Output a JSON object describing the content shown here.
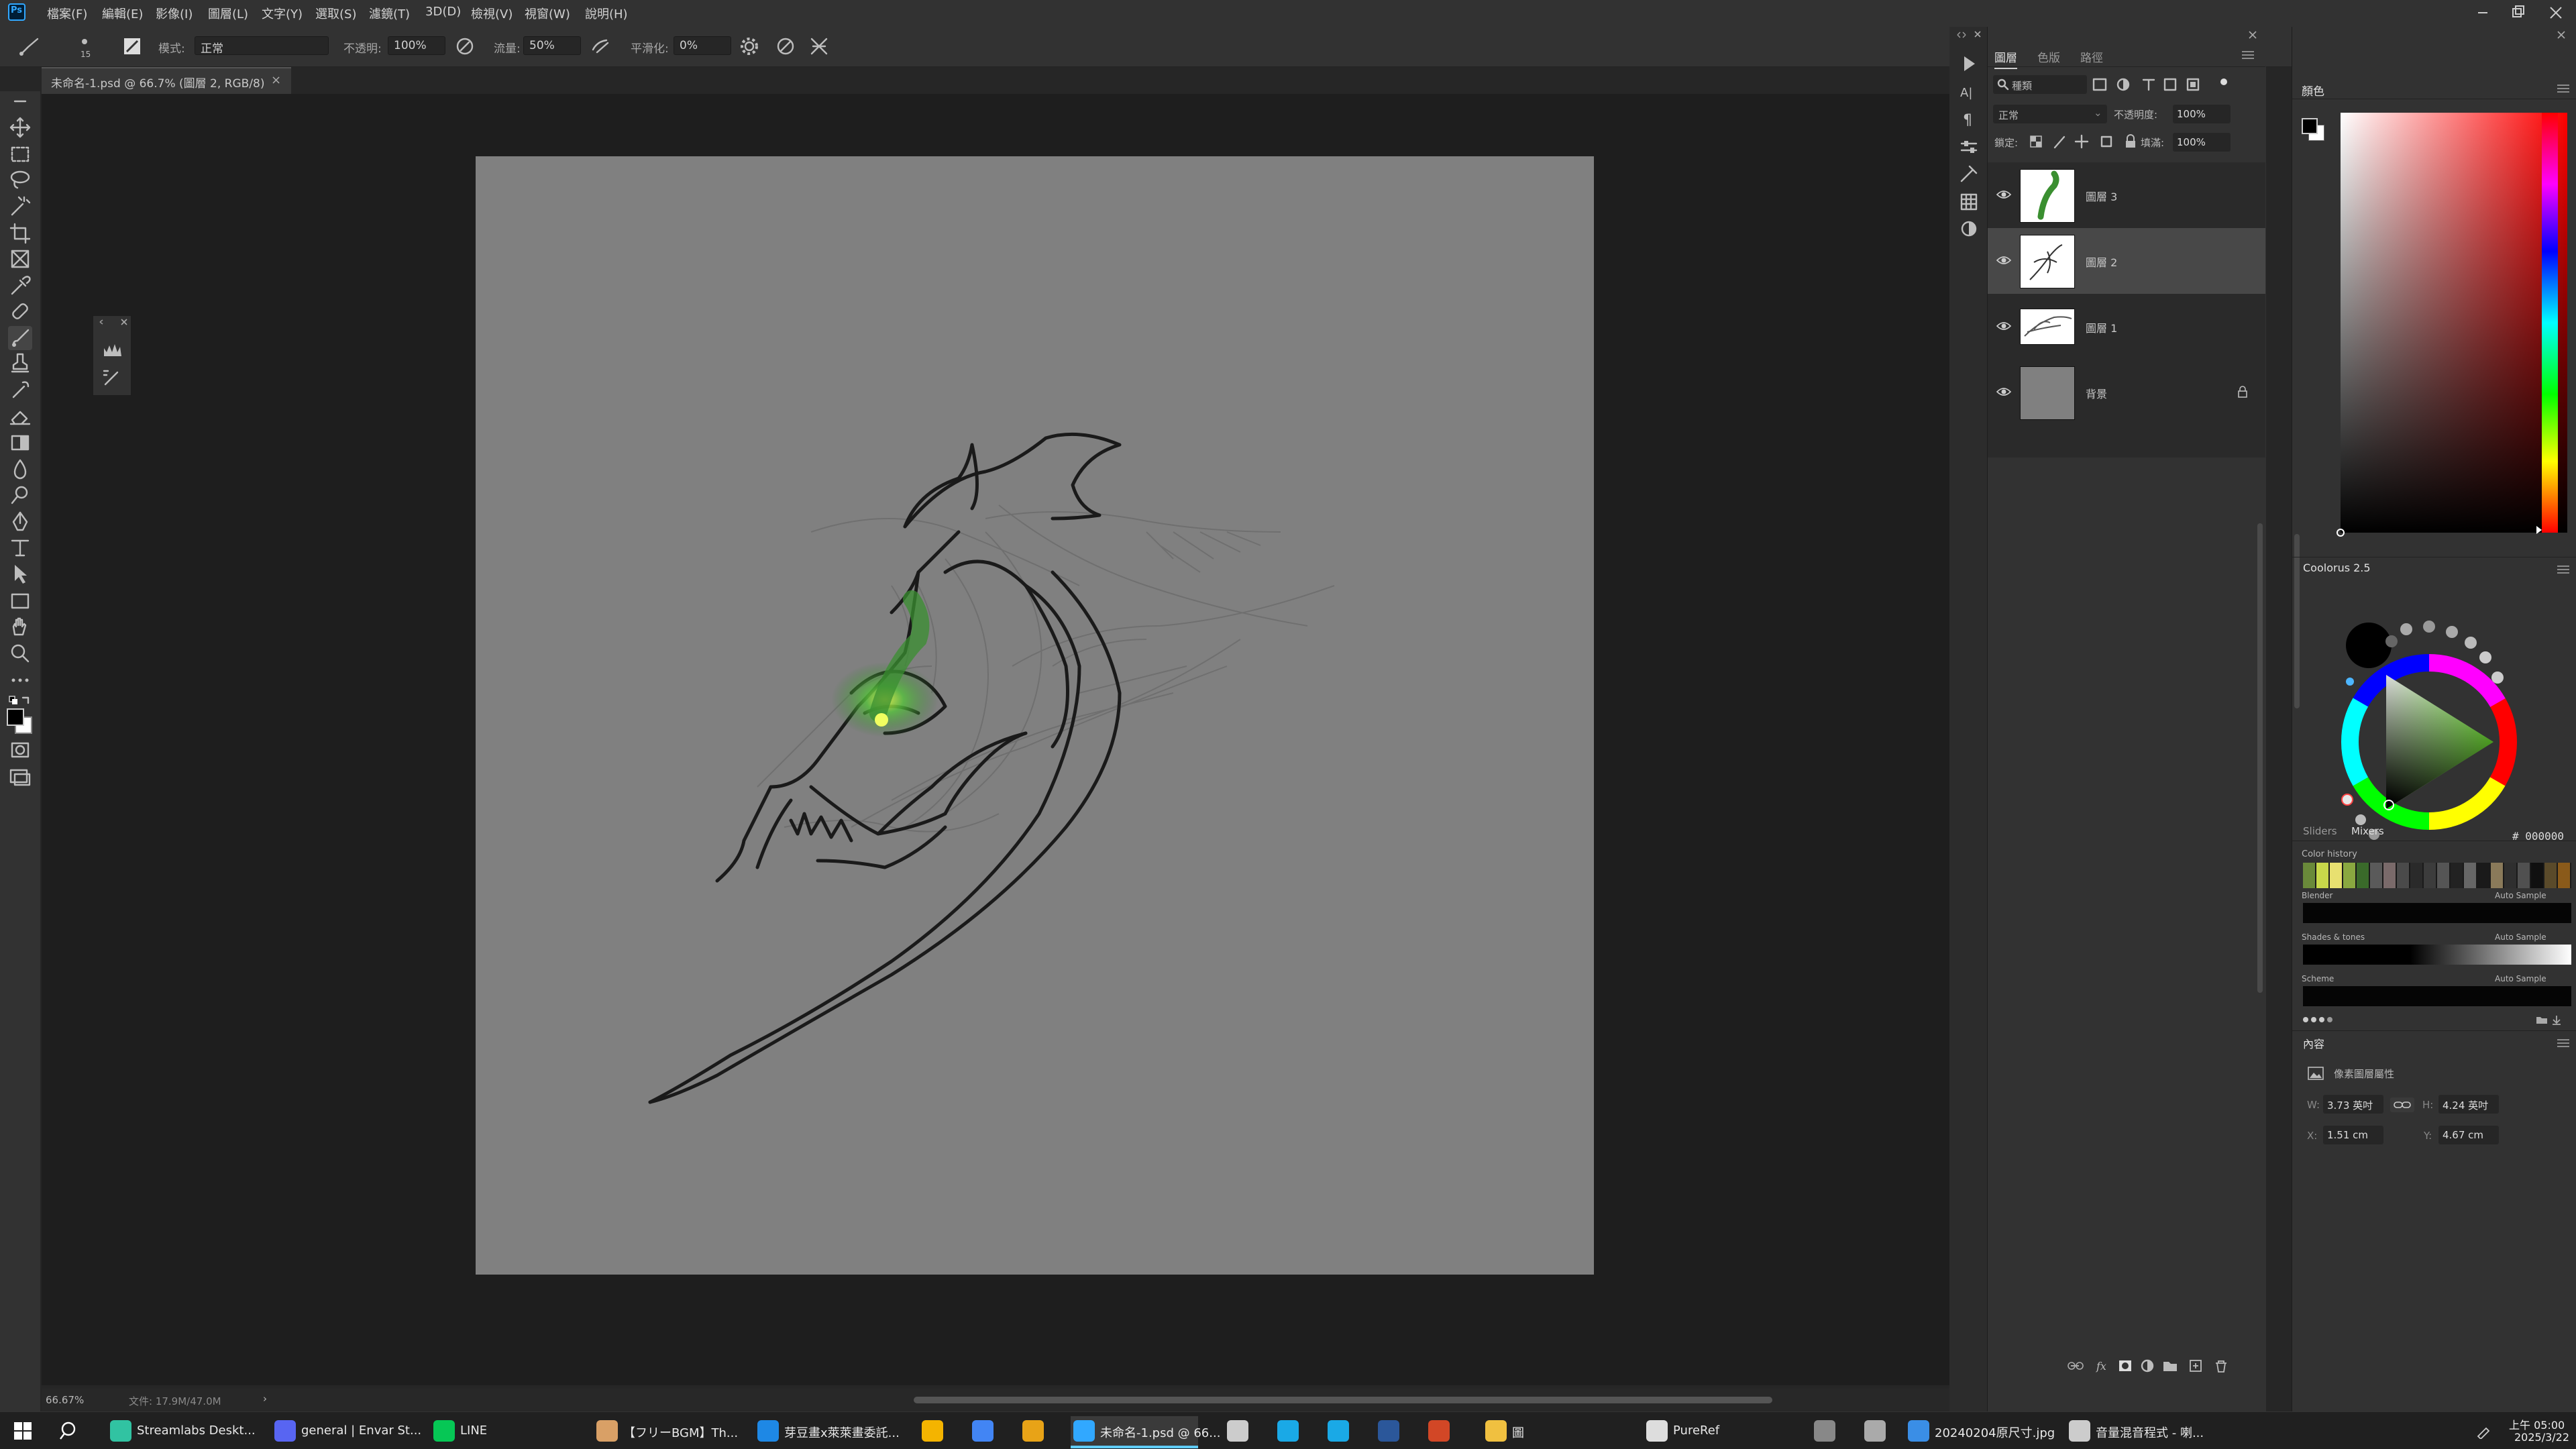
{
  "app": {
    "logo": "Ps",
    "menu": [
      "檔案(F)",
      "編輯(E)",
      "影像(I)",
      "圖層(L)",
      "文字(Y)",
      "選取(S)",
      "濾鏡(T)",
      "3D(D)",
      "檢視(V)",
      "視窗(W)",
      "說明(H)"
    ]
  },
  "options": {
    "brush_size": "15",
    "mode_label": "模式:",
    "mode_value": "正常",
    "opacity_label": "不透明:",
    "opacity_value": "100%",
    "flow_label": "流量:",
    "flow_value": "50%",
    "smoothing_label": "平滑化:",
    "smoothing_value": "0%"
  },
  "document": {
    "tab_title": "未命名-1.psd @ 66.7% (圖層 2, RGB/8)",
    "close_glyph": "×",
    "canvas_color": "#808080",
    "eye_glow_color": "#3fa83a"
  },
  "status": {
    "zoom": "66.67%",
    "doc_size": "文件: 17.9M/47.0M",
    "arrow": "›"
  },
  "layers_panel": {
    "tabs": [
      "圖層",
      "色版",
      "路徑"
    ],
    "filter_label": "種類",
    "blend_mode": "正常",
    "opacity_label": "不透明度:",
    "opacity_value": "100%",
    "lock_label": "鎖定:",
    "fill_label": "填滿:",
    "fill_value": "100%",
    "layers": [
      {
        "name": "圖層 3",
        "selected": false
      },
      {
        "name": "圖層 2",
        "selected": true
      },
      {
        "name": "圖層 1",
        "selected": false
      },
      {
        "name": "背景",
        "selected": false,
        "locked": true
      }
    ]
  },
  "color_panel": {
    "title": "顏色",
    "hue_color": "#ff0000"
  },
  "coolorus": {
    "title": "Coolorus 2.5",
    "hex_value": "# 000000",
    "tabs": [
      "Sliders",
      "Mixers"
    ],
    "color_history_label": "Color history",
    "history_colors": [
      "#6a8a3a",
      "#c8d84a",
      "#e8e070",
      "#8aa840",
      "#3a6a2a",
      "#5a5a5a",
      "#7a6a6a",
      "#4a4a4a",
      "#2a2a2a",
      "#3c3c3c",
      "#555",
      "#222",
      "#666",
      "#1a1a1a",
      "#8a7a5a",
      "#2f2f2f",
      "#505050",
      "#101010",
      "#5a4a2a",
      "#8a5a1a"
    ],
    "mixers": [
      {
        "label": "Blender",
        "auto": "Auto Sample"
      },
      {
        "label": "Shades & tones",
        "auto": "Auto Sample"
      },
      {
        "label": "Scheme",
        "auto": "Auto Sample"
      }
    ]
  },
  "properties": {
    "title": "內容",
    "subtitle": "像素圖層屬性",
    "w_label": "W:",
    "w_value": "3.73 英吋",
    "h_label": "H:",
    "h_value": "4.24 英吋",
    "x_label": "X:",
    "x_value": "1.51 cm",
    "y_label": "Y:",
    "y_value": "4.67 cm"
  },
  "taskbar": {
    "items": [
      {
        "label": "Streamlabs Deskt...",
        "color": "#31c3a2"
      },
      {
        "label": "general | Envar St...",
        "color": "#5865f2"
      },
      {
        "label": "LINE",
        "color": "#06c755"
      },
      {
        "label": "【フリーBGM】Th...",
        "color": "#d9a066"
      },
      {
        "label": "芽豆畫x萊萊畫委託...",
        "color": "#1e88e5"
      },
      {
        "label": "",
        "color": "#f4b400"
      },
      {
        "label": "",
        "color": "#4285f4"
      },
      {
        "label": "",
        "color": "#e8a317"
      },
      {
        "label": "未命名-1.psd @ 66...",
        "color": "#31a8ff"
      },
      {
        "label": "",
        "color": "#cccccc"
      },
      {
        "label": "",
        "color": "#1aa9e6"
      },
      {
        "label": "",
        "color": "#1aa9e6"
      },
      {
        "label": "",
        "color": "#2b579a"
      },
      {
        "label": "",
        "color": "#d24726"
      },
      {
        "label": "圖",
        "color": "#f0c040"
      },
      {
        "label": "PureRef",
        "color": "#dddddd"
      },
      {
        "label": "",
        "color": "#888888"
      },
      {
        "label": "",
        "color": "#aaaaaa"
      },
      {
        "label": "20240204原尺寸.jpg",
        "color": "#3a8ee6"
      },
      {
        "label": "音量混音程式 - 喇...",
        "color": "#cccccc"
      }
    ],
    "clock_time": "上午 05:00",
    "clock_date": "2025/3/22"
  }
}
